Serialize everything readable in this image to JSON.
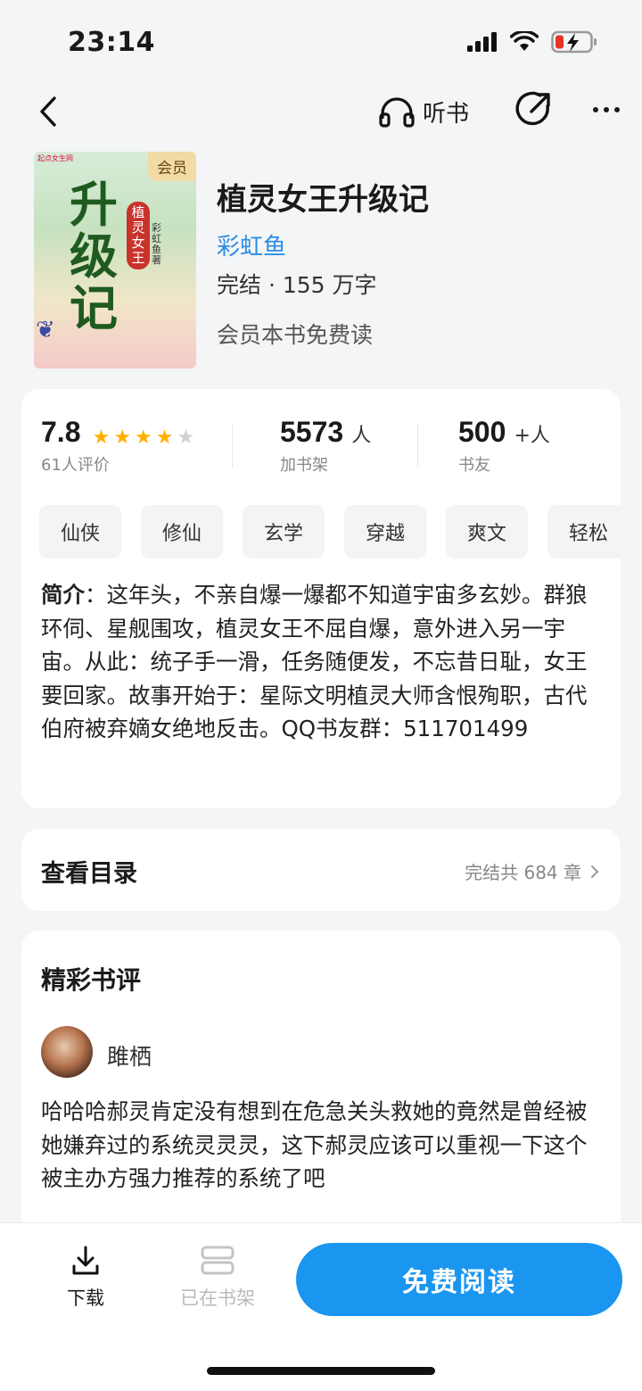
{
  "status_bar": {
    "time": "23:14"
  },
  "nav": {
    "listen_label": "听书"
  },
  "book": {
    "title": "植灵女王升级记",
    "author": "彩虹鱼",
    "meta": "完结 · 155 万字",
    "free_text": "会员本书免费读",
    "cover": {
      "badge": "会员",
      "logo": "起点女生网",
      "title_chars": "升级记",
      "subtitle": "植灵女王",
      "author_mark": "彩虹鱼著"
    }
  },
  "stats": {
    "rating": "7.8",
    "rating_stars": 4,
    "rating_label": "61人评价",
    "shelf_count": "5573",
    "shelf_unit": "人",
    "shelf_label": "加书架",
    "friends_count": "500",
    "friends_unit": "+人",
    "friends_label": "书友"
  },
  "tags": [
    "仙侠",
    "修仙",
    "玄学",
    "穿越",
    "爽文",
    "轻松"
  ],
  "intro": {
    "label": "简介",
    "text": "：这年头，不亲自爆一爆都不知道宇宙多玄妙。群狼环伺、星舰围攻，植灵女王不屈自爆，意外进入另一宇宙。从此：统子手一滑，任务随便发，不忘昔日耻，女王要回家。故事开始于：星际文明植灵大师含恨殉职，古代伯府被弃嫡女绝地反击。QQ书友群：511701499"
  },
  "toc": {
    "label": "查看目录",
    "status": "完结共 684 章"
  },
  "reviews": {
    "title": "精彩书评",
    "items": [
      {
        "user": "雎栖",
        "text": "哈哈哈郝灵肯定没有想到在危急关头救她的竟然是曾经被她嫌弃过的系统灵灵灵，这下郝灵应该可以重视一下这个被主办方强力推荐的系统了吧"
      }
    ]
  },
  "bottom_bar": {
    "download_label": "下载",
    "shelf_label": "已在书架",
    "read_label": "免费阅读"
  },
  "colors": {
    "accent": "#1a96f0",
    "author_link": "#2b8ce6",
    "star": "#ffb100",
    "battery_low": "#e5352b"
  }
}
